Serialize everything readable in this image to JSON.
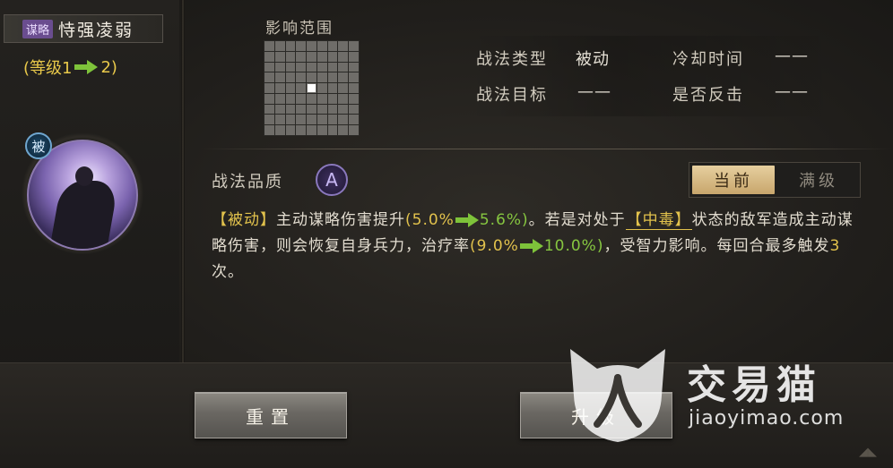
{
  "skill": {
    "type_badge": "谋略",
    "name": "恃强凌弱",
    "level_open": "(等级1",
    "level_close": "2)",
    "passive_badge": "被"
  },
  "range": {
    "title": "影响范围",
    "grid_size": 9,
    "center_highlight": true
  },
  "info": {
    "type_label": "战法类型",
    "type_value": "被动",
    "target_label": "战法目标",
    "target_value": "——",
    "cooldown_label": "冷却时间",
    "cooldown_value": "——",
    "counter_label": "是否反击",
    "counter_value": "——"
  },
  "quality": {
    "label": "战法品质",
    "grade": "A"
  },
  "tabs": {
    "current": "当前",
    "max": "满级"
  },
  "description": {
    "tag": "【被动】",
    "p1": "主动谋略伤害提升",
    "v1_open": "(5.0%",
    "v1_close": "5.6%)",
    "p2": "。若是对处于",
    "status": "【中毒】",
    "p3": "状态的敌军造成主动谋略伤害，则会恢复自身兵力，治疗率",
    "v2_open": "(9.0%",
    "v2_close": "10.0%)",
    "p4": "，受智力影响。每回合最多触发",
    "count": "3",
    "p5": "次。"
  },
  "buttons": {
    "reset": "重置",
    "upgrade": "升级"
  },
  "watermark": {
    "title": "交易猫",
    "url": "jiaoyimao.com"
  },
  "colors": {
    "highlight_yellow": "#e2c24c",
    "highlight_green": "#86c640",
    "quality_purple": "#8a78bd",
    "tab_active_gold": "#d6b67f"
  }
}
